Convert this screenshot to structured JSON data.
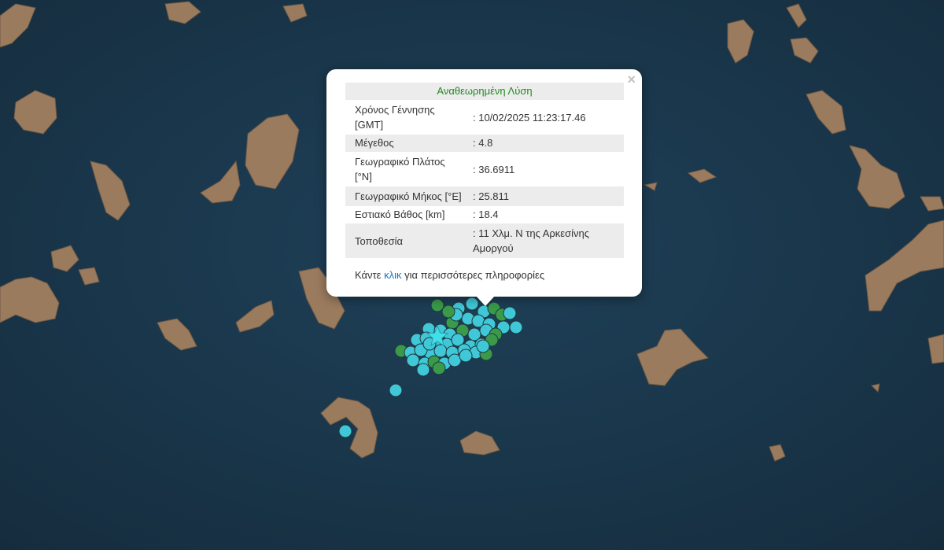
{
  "popup": {
    "header": "Αναθεωρημένη Λύση",
    "close_label": "×",
    "rows": [
      {
        "label": "Χρόνος Γέννησης [GMT]",
        "value": ": 10/02/2025 11:23:17.46"
      },
      {
        "label": "Μέγεθος",
        "value": ": 4.8"
      },
      {
        "label": "Γεωγραφικό Πλάτος [°N]",
        "value": ": 36.6911"
      },
      {
        "label": "Γεωγραφικό Μήκος [°E]",
        "value": ": 25.811"
      },
      {
        "label": "Εστιακό Βάθος [km]",
        "value": ": 18.4"
      },
      {
        "label": "Τοποθεσία",
        "value": ": 11 Χλμ. N της Αρκεσίνης Αμοργού"
      }
    ],
    "more_prefix": "Κάντε",
    "more_link": "κλικ",
    "more_suffix": "για περισσότερες πληροφορίες"
  },
  "colors": {
    "sea": "#1d3a4e",
    "land": "#9a7a5c",
    "event_recent": "#40c8d8",
    "event_older": "#3a9a4a",
    "selected_event": "#40e0e8",
    "header_text": "#1f8a1f",
    "link": "#1a73c8"
  },
  "map": {
    "selected_marker_icon": "star-icon"
  }
}
